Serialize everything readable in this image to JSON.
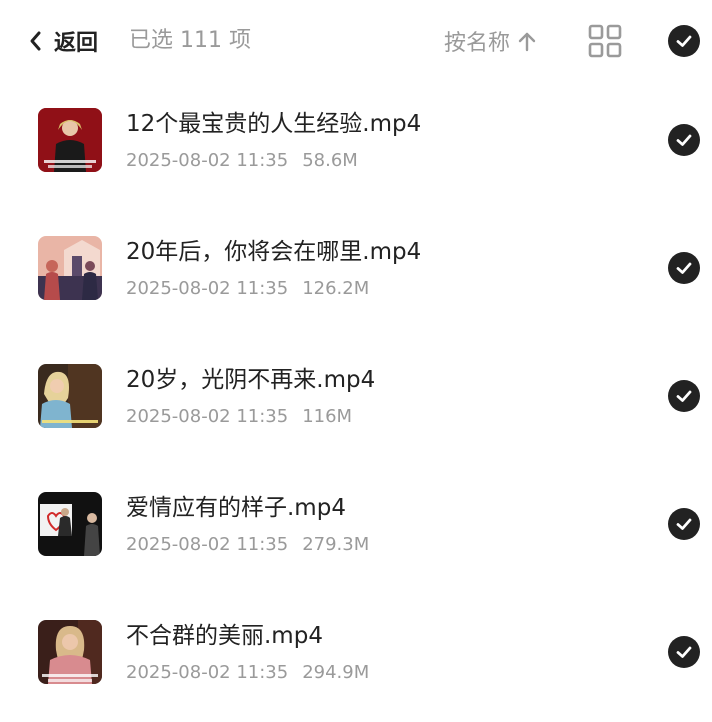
{
  "header": {
    "back_label": "返回",
    "selected_text": "已选 111 项",
    "sort_label": "按名称"
  },
  "files": [
    {
      "name": "12个最宝贵的人生经验.mp4",
      "date": "2025-08-02 11:35",
      "size": "58.6M"
    },
    {
      "name": "20年后，你将会在哪里.mp4",
      "date": "2025-08-02 11:35",
      "size": "126.2M"
    },
    {
      "name": "20岁，光阴不再来.mp4",
      "date": "2025-08-02 11:35",
      "size": "116M"
    },
    {
      "name": "爱情应有的样子.mp4",
      "date": "2025-08-02 11:35",
      "size": "279.3M"
    },
    {
      "name": "不合群的美丽.mp4",
      "date": "2025-08-02 11:35",
      "size": "294.9M"
    }
  ]
}
